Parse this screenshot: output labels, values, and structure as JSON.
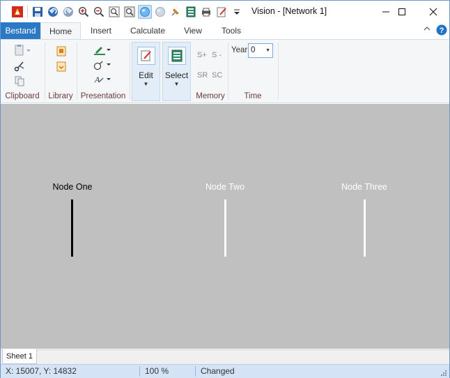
{
  "window": {
    "title": "Vision - [Network 1]"
  },
  "quick_access": {
    "icons": [
      "app-icon",
      "save-icon",
      "undo-icon",
      "redo-icon",
      "zoom-in-icon",
      "zoom-out-icon",
      "zoom-window-icon",
      "zoom-all-icon",
      "select-sphere-icon",
      "sphere-icon",
      "pin-icon",
      "display-icon",
      "print-icon",
      "edit-icon",
      "customize-dropdown-icon"
    ]
  },
  "tabs": [
    "Bestand",
    "Home",
    "Insert",
    "Calculate",
    "View",
    "Tools"
  ],
  "ribbon": {
    "groups": {
      "clipboard": "Clipboard",
      "library": "Library",
      "presentation": "Presentation",
      "memory": "Memory",
      "time": "Time"
    },
    "edit_label": "Edit",
    "select_label": "Select",
    "memory": {
      "s_plus": "S+",
      "s_minus": "S -",
      "sr": "SR",
      "sc": "SC"
    },
    "year_label": "Year",
    "year_value": "0"
  },
  "canvas": {
    "background": "#c0c0c0",
    "nodes": [
      {
        "label": "Node One",
        "color": "#000000"
      },
      {
        "label": "Node Two",
        "color": "#ffffff"
      },
      {
        "label": "Node Three",
        "color": "#ffffff"
      }
    ]
  },
  "sheets": [
    "Sheet 1"
  ],
  "status": {
    "coords": "X: 15007, Y: 14832",
    "zoom": "100 %",
    "state": "Changed"
  }
}
